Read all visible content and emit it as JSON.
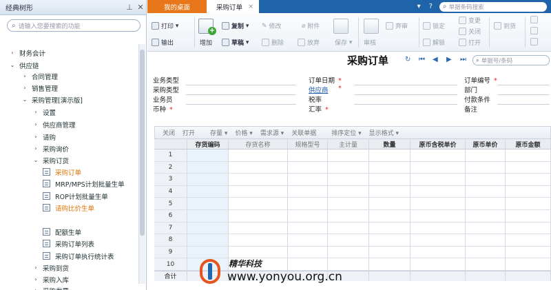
{
  "sidebar": {
    "title": "经典树形",
    "pin_icon": "pin-icon",
    "close_icon": "close-icon",
    "search_placeholder": "请输入您要搜索的功能",
    "tree": [
      {
        "label": "财务会计",
        "arrow": "›"
      },
      {
        "label": "供应链",
        "arrow": "⌄"
      },
      {
        "label": "合同管理",
        "arrow": "›"
      },
      {
        "label": "销售管理",
        "arrow": "›"
      },
      {
        "label": "采购管理[演示版]",
        "arrow": "⌄"
      },
      {
        "label": "设置",
        "arrow": "›"
      },
      {
        "label": "供应商管理",
        "arrow": "›"
      },
      {
        "label": "请购",
        "arrow": "›"
      },
      {
        "label": "采购询价",
        "arrow": "›"
      },
      {
        "label": "采购订货",
        "arrow": "⌄"
      },
      {
        "label": "采购订单",
        "arrow": ""
      },
      {
        "label": "MRP/MPS计划批量生单",
        "arrow": ""
      },
      {
        "label": "ROP计划批量生单",
        "arrow": ""
      },
      {
        "label": "请购比价生单",
        "arrow": ""
      },
      {
        "label": "配额生单",
        "arrow": ""
      },
      {
        "label": "采购订单列表",
        "arrow": ""
      },
      {
        "label": "采购订单执行统计表",
        "arrow": ""
      },
      {
        "label": "采购到货",
        "arrow": "›"
      },
      {
        "label": "采购入库",
        "arrow": "›"
      },
      {
        "label": "采购发票",
        "arrow": "›"
      }
    ]
  },
  "tabs": {
    "desktop": "我的桌面",
    "current": "采购订单",
    "close": "×"
  },
  "topbar": {
    "search_placeholder": "单据条码搜索",
    "help": "?"
  },
  "toolbar": {
    "print": "打印",
    "output": "输出",
    "add": "增加",
    "copy": "复制",
    "modify": "修改",
    "attach": "附件",
    "draft": "草稿",
    "delete": "删除",
    "discard": "放弃",
    "save": "保存",
    "approve": "审核",
    "abandon": "弃审",
    "lock": "锁定",
    "unlock": "解锁",
    "change": "变更",
    "close": "关闭",
    "open": "打开",
    "arrive": "到货"
  },
  "doc": {
    "title": "采购订单",
    "search_placeholder": "单据号/条码"
  },
  "form": {
    "business_type": "业务类型",
    "purchase_type": "采购类型",
    "salesman": "业务员",
    "currency": "币种",
    "order_date": "订单日期",
    "supplier": "供应商",
    "tax_rate": "税率",
    "exchange_rate": "汇率",
    "order_no": "订单编号",
    "department": "部门",
    "payment_terms": "付款条件",
    "note": "备注",
    "required_mark": "*"
  },
  "gridbar": [
    "关闭",
    "打开",
    "存量 ▾",
    "价格 ▾",
    "需求源 ▾",
    "关联单据",
    "排序定位 ▾",
    "显示格式 ▾"
  ],
  "grid": {
    "columns": [
      "",
      "存货编码",
      "存货名称",
      "规格型号",
      "主计量",
      "数量",
      "原币含税单价",
      "原币单价",
      "原币金额"
    ],
    "rows": [
      "1",
      "2",
      "3",
      "4",
      "5",
      "6",
      "7",
      "8",
      "9",
      "10"
    ],
    "total_label": "合计"
  },
  "watermark": {
    "cn": "精华科技",
    "url": "www.yonyou.org.cn"
  }
}
